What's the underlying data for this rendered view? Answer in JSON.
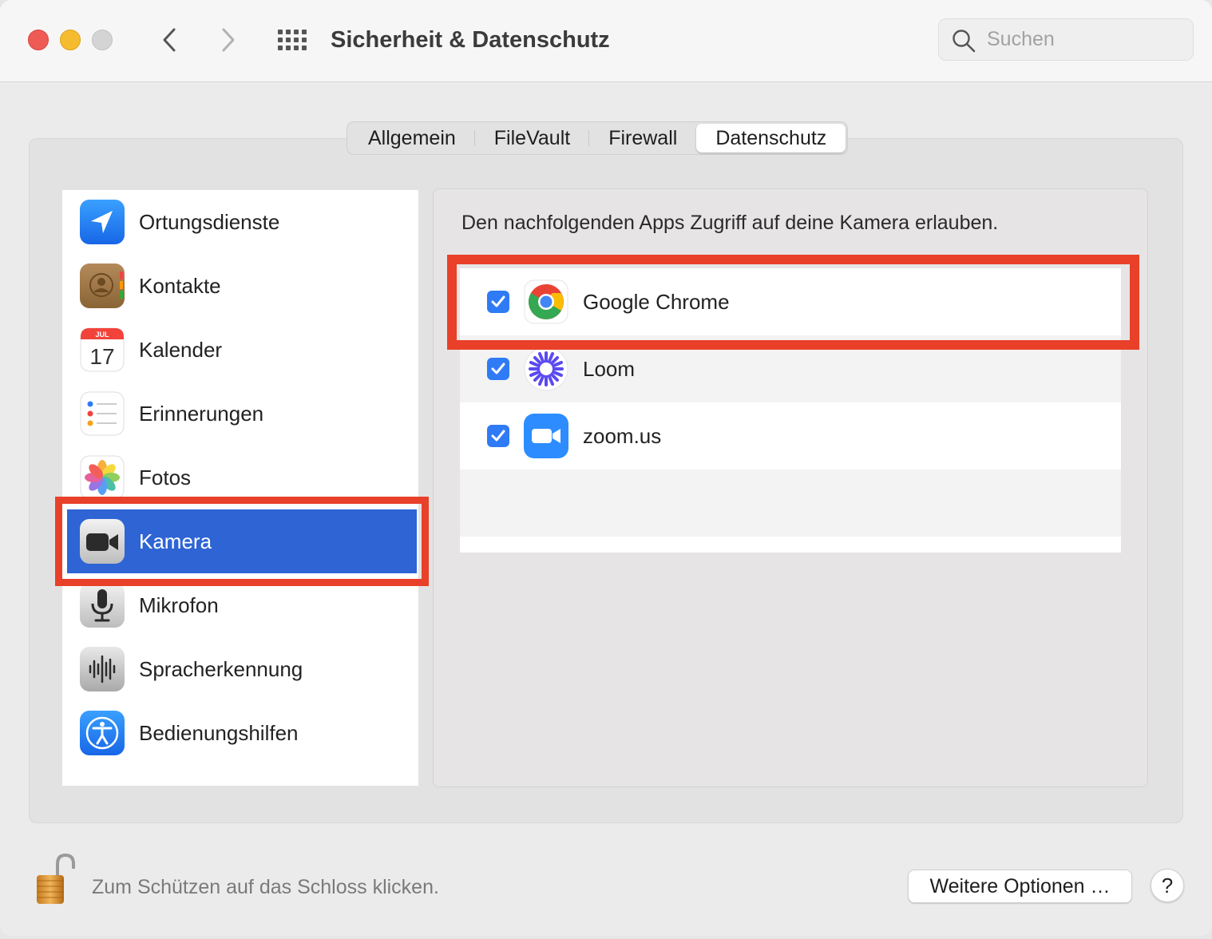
{
  "window": {
    "title": "Sicherheit & Datenschutz",
    "search_placeholder": "Suchen"
  },
  "tabs": [
    {
      "label": "Allgemein",
      "active": false
    },
    {
      "label": "FileVault",
      "active": false
    },
    {
      "label": "Firewall",
      "active": false
    },
    {
      "label": "Datenschutz",
      "active": true
    }
  ],
  "sidebar": {
    "items": [
      {
        "label": "Ortungsdienste",
        "icon": "location-arrow-icon"
      },
      {
        "label": "Kontakte",
        "icon": "contacts-icon"
      },
      {
        "label": "Kalender",
        "icon": "calendar-icon",
        "calendar_month": "JUL",
        "calendar_day": "17"
      },
      {
        "label": "Erinnerungen",
        "icon": "reminders-icon"
      },
      {
        "label": "Fotos",
        "icon": "photos-icon"
      },
      {
        "label": "Kamera",
        "icon": "camera-icon",
        "selected": true
      },
      {
        "label": "Mikrofon",
        "icon": "microphone-icon"
      },
      {
        "label": "Spracherkennung",
        "icon": "waveform-icon"
      },
      {
        "label": "Bedienungshilfen",
        "icon": "accessibility-icon"
      }
    ]
  },
  "panel": {
    "description": "Den nachfolgenden Apps Zugriff auf deine Kamera erlauben.",
    "apps": [
      {
        "label": "Google Chrome",
        "checked": true,
        "icon": "chrome-icon"
      },
      {
        "label": "Loom",
        "checked": true,
        "icon": "loom-icon"
      },
      {
        "label": "zoom.us",
        "checked": true,
        "icon": "zoom-icon"
      }
    ]
  },
  "footer": {
    "lock_text": "Zum Schützen auf das Schloss klicken.",
    "more_options": "Weitere Optionen …",
    "help": "?"
  },
  "colors": {
    "highlight": "#e9402a",
    "selection": "#2e64d4",
    "checkbox": "#2f7bf5"
  }
}
